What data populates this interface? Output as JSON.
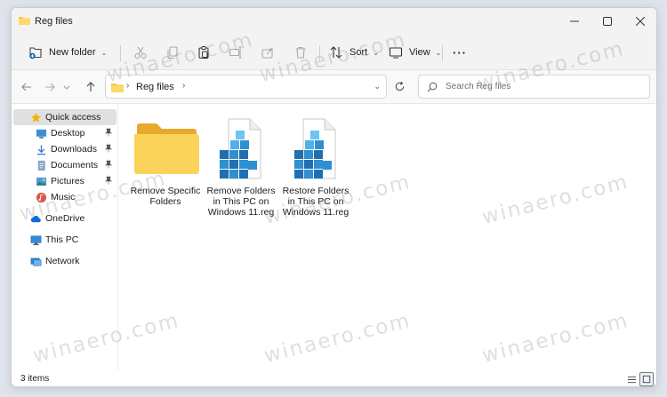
{
  "window": {
    "title": "Reg files",
    "controls": [
      "minimize",
      "maximize",
      "close"
    ]
  },
  "toolbar": {
    "new_folder_label": "New folder",
    "sort_label": "Sort",
    "view_label": "View",
    "more_label": "···",
    "icons": [
      "new-folder-icon",
      "cut-icon",
      "copy-icon",
      "paste-icon",
      "rename-icon",
      "share-icon",
      "delete-icon",
      "sort-icon",
      "view-icon"
    ]
  },
  "navigation": {
    "breadcrumb": [
      "Reg files"
    ],
    "search_placeholder": "Search Reg files"
  },
  "sidebar": {
    "items": [
      {
        "label": "Quick access",
        "icon": "star-icon",
        "pinned": false,
        "selected": true
      },
      {
        "label": "Desktop",
        "icon": "desktop-icon",
        "pinned": true
      },
      {
        "label": "Downloads",
        "icon": "download-icon",
        "pinned": true
      },
      {
        "label": "Documents",
        "icon": "documents-icon",
        "pinned": true
      },
      {
        "label": "Pictures",
        "icon": "pictures-icon",
        "pinned": true
      },
      {
        "label": "Music",
        "icon": "music-icon",
        "pinned": false
      },
      {
        "label": "OneDrive",
        "icon": "cloud-icon",
        "pinned": false
      },
      {
        "label": "This PC",
        "icon": "computer-icon",
        "pinned": false
      },
      {
        "label": "Network",
        "icon": "network-icon",
        "pinned": false
      }
    ]
  },
  "files": [
    {
      "name": "Remove Specific Folders",
      "type": "folder",
      "icon": "folder-icon"
    },
    {
      "name": "Remove Folders in This PC on Windows 11.reg",
      "type": "reg",
      "icon": "registry-file-icon"
    },
    {
      "name": "Restore Folders in This PC on Windows 11.reg",
      "type": "reg",
      "icon": "registry-file-icon"
    }
  ],
  "status": {
    "item_count": "3 items"
  },
  "watermark": "winaero.com",
  "colors": {
    "accent": "#0067c0",
    "folder": "#f7c948",
    "registry": "#2e8fd1"
  }
}
